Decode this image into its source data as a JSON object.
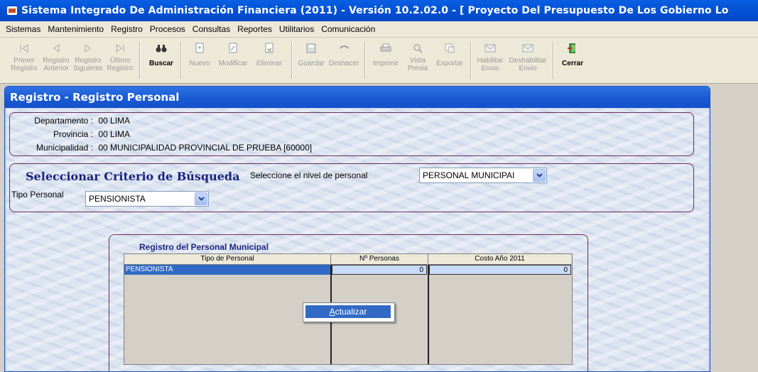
{
  "window": {
    "title": "Sistema Integrado De Administración Financiera (2011) - Versión 10.2.02.0 - [ Proyecto Del Presupuesto De Los Gobierno Lo"
  },
  "menu": [
    "Sistemas",
    "Mantenimiento",
    "Registro",
    "Procesos",
    "Consultas",
    "Reportes",
    "Utilitarios",
    "Comunicación"
  ],
  "toolbar": {
    "first": [
      "Primer",
      "Registro"
    ],
    "prev": [
      "Registro",
      "Anterior"
    ],
    "next": [
      "Registro",
      "Siguiente"
    ],
    "last": [
      "Último",
      "Registro"
    ],
    "search": "Buscar",
    "new": "Nuevo",
    "edit": "Modificar",
    "delete": "Eliminar",
    "save": "Guardar",
    "undo": "Deshacer",
    "print": "Imprimir",
    "preview": [
      "Vista",
      "Previa"
    ],
    "export": "Exportar",
    "enable": [
      "Habilitar",
      "Envio"
    ],
    "disable": [
      "Deshabilitar",
      "Envio"
    ],
    "close": "Cerrar"
  },
  "form": {
    "title": "Registro - Registro Personal",
    "location": {
      "departamento_label": "Departamento :",
      "departamento_value": "00  LIMA",
      "provincia_label": "Provincia :",
      "provincia_value": "00  LIMA",
      "municipalidad_label": "Municipalidad :",
      "municipalidad_value": "00  MUNICIPALIDAD PROVINCIAL DE PRUEBA [60000]"
    },
    "criteria": {
      "title": "Seleccionar Criterio de Búsqueda",
      "level_label": "Seleccione el nivel de personal",
      "level_value": "PERSONAL MUNICIPAI",
      "tipo_label": "Tipo Personal",
      "tipo_value": "PENSIONISTA"
    },
    "grid": {
      "title": "Registro del Personal Municipal",
      "columns": [
        "Tipo de Personal",
        "Nº Personas",
        "Costo Año 2011"
      ],
      "rows": [
        [
          "PENSIONISTA",
          "0",
          "0"
        ]
      ]
    },
    "context_menu": {
      "item": "Actualizar"
    }
  },
  "colors": {
    "titlebar": "#0454d6",
    "window_title": "#1a5cd6",
    "group_border": "#6e2a5c",
    "selection": "#316ac5",
    "heading_text": "#1a237e"
  }
}
